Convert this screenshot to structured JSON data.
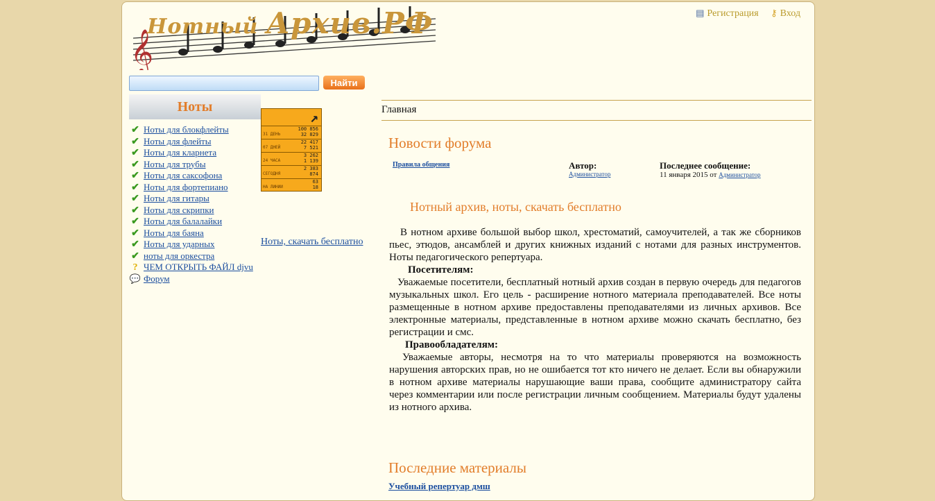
{
  "header": {
    "logo_text_1": "Нотный",
    "logo_text_2": "Архив.РФ",
    "register_label": "Регистрация",
    "login_label": "Вход",
    "register_icon": "id-card-icon",
    "login_icon": "key-icon"
  },
  "search": {
    "value": "",
    "button_label": "Найти"
  },
  "sidebar": {
    "title": "Ноты",
    "items": [
      {
        "label": "Ноты для блокфлейты",
        "icon": "check-icon"
      },
      {
        "label": "Ноты для флейты",
        "icon": "check-icon"
      },
      {
        "label": "Ноты для кларнета",
        "icon": "check-icon"
      },
      {
        "label": "Ноты для трубы",
        "icon": "check-icon"
      },
      {
        "label": "Ноты для саксофона",
        "icon": "check-icon"
      },
      {
        "label": "Ноты для фортепиано",
        "icon": "check-icon"
      },
      {
        "label": "Ноты для гитары",
        "icon": "check-icon"
      },
      {
        "label": "Ноты для скрипки",
        "icon": "check-icon"
      },
      {
        "label": "Ноты для балалайки",
        "icon": "check-icon"
      },
      {
        "label": "Ноты для баяна",
        "icon": "check-icon"
      },
      {
        "label": "Ноты для ударных",
        "icon": "check-icon"
      },
      {
        "label": "ноты для оркестра",
        "icon": "check-icon"
      },
      {
        "label": "ЧЕМ ОТКРЫТЬ ФАЙЛ djvu",
        "icon": "question-icon"
      },
      {
        "label": "Форум",
        "icon": "chat-bubbles-icon"
      }
    ],
    "side_link": "Ноты, скачать бесплатно"
  },
  "counter": {
    "rows": [
      {
        "label": "31 ДЕНЬ",
        "v1": "100 856",
        "v2": "32 829"
      },
      {
        "label": "07 ДНЕЙ",
        "v1": "22 417",
        "v2": "7 521"
      },
      {
        "label": "24 ЧАСА",
        "v1": "3 262",
        "v2": "1 139"
      },
      {
        "label": "СЕГОДНЯ",
        "v1": "2 383",
        "v2": "874"
      },
      {
        "label": "НА ЛИНИИ",
        "v1": "63",
        "v2": "18"
      }
    ]
  },
  "main": {
    "breadcrumb": "Главная",
    "forum_news_title": "Новости форума",
    "forum_rules_link": "Правила общения",
    "author_label": "Автор:",
    "author_value": "Администратор",
    "last_message_label": "Последнее сообщение:",
    "last_message_date": "11 января 2015 от",
    "last_message_author": "Администратор",
    "article_title": "Нотный архив, ноты, скачать бесплатно",
    "paragraph_1": "В нотном архиве большой выбор школ, хрестоматий, самоучителей, а так же сборников пьес, этюдов, ансамблей и других книжных изданий с нотами для разных инструментов.  Ноты педагогического репертуара.",
    "visitors_heading": "Посетителям:",
    "paragraph_2": "Уважаемые посетители, бесплатный нотный архив создан в первую очередь для педагогов музыкальных школ. Его цель - расширение нотного материала преподавателей. Все ноты размещенные в нотном архиве предоставлены преподавателями из личных архивов. Все электронные материалы, представленные в нотном архиве можно скачать бесплатно, без регистрации и смс.",
    "rightholders_heading": "Правообладателям:",
    "paragraph_3": "Уважаемые авторы, несмотря на то что материалы проверяются на возможность нарушения авторских прав, но не ошибается тот кто ничего не делает. Если вы обнаружили в нотном архиве материалы нарушающие ваши права, сообщите администратору сайта через комментарии или после регистрации личным сообщением. Материалы будут удалены из нотного архива.",
    "latest_title": "Последние материалы",
    "latest_link": "Учебный репертуар дмш"
  }
}
